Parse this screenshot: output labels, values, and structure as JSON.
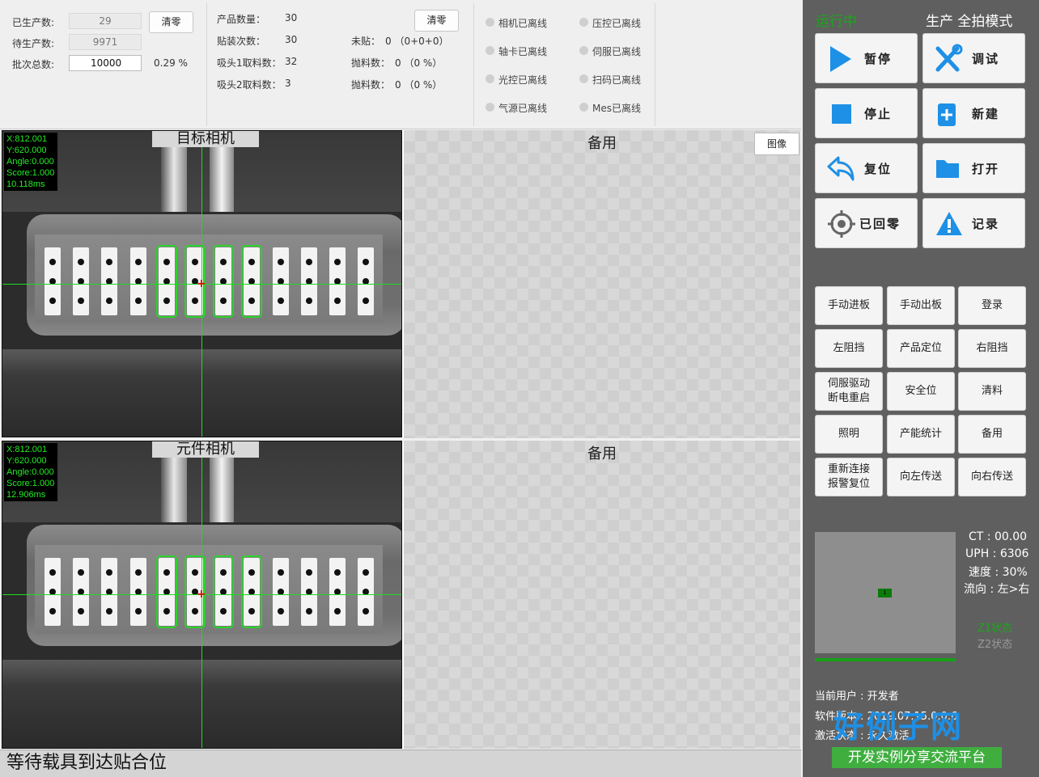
{
  "counters": {
    "produced_label": "已生产数:",
    "produced_value": "29",
    "remaining_label": "待生产数:",
    "remaining_value": "9971",
    "batch_label": "批次总数:",
    "batch_value": "10000",
    "batch_percent": "0.29 %",
    "clear_label": "清零"
  },
  "product": {
    "qty_label": "产品数量：",
    "qty_value": "30",
    "mount_label": "贴装次数：",
    "mount_value": "30",
    "nozzle1_label": "吸头1取料数：",
    "nozzle1_value": "32",
    "nozzle2_label": "吸头2取料数：",
    "nozzle2_value": "3",
    "unmounted_label": "未贴：",
    "unmounted_value": "0 （0+0+0）",
    "throw1_label": "抛料数：",
    "throw1_value": "0 （0 %）",
    "throw2_label": "抛料数：",
    "throw2_value": "0 （0 %）",
    "clear_label": "清零"
  },
  "statuses": [
    "相机已离线",
    "压控已离线",
    "轴卡已离线",
    "伺服已离线",
    "光控已离线",
    "扫码已离线",
    "气源已离线",
    "Mes已离线"
  ],
  "camera_target": {
    "title": "目标相机",
    "overlay": [
      "X:812.001",
      "Y:620.000",
      "Angle:0.000",
      "Score:1.000",
      "10.118ms"
    ]
  },
  "camera_part": {
    "title": "元件相机",
    "overlay": [
      "X:812.001",
      "Y:620.000",
      "Angle:0.000",
      "Score:1.000",
      "12.906ms"
    ]
  },
  "spare_title": "备用",
  "image_button": "图像",
  "status_message": "等待载具到达贴合位",
  "right": {
    "run_state": "运行中",
    "mode": "生产  全拍模式",
    "big_buttons": [
      {
        "label": "暂停",
        "icon": "play-icon"
      },
      {
        "label": "调试",
        "icon": "tools-icon"
      },
      {
        "label": "停止",
        "icon": "stop-icon"
      },
      {
        "label": "新建",
        "icon": "new-file-icon"
      },
      {
        "label": "复位",
        "icon": "undo-icon"
      },
      {
        "label": "打开",
        "icon": "folder-icon"
      },
      {
        "label": "已回零",
        "icon": "target-icon"
      },
      {
        "label": "记录",
        "icon": "warning-icon"
      }
    ],
    "small_buttons": [
      "手动进板",
      "手动出板",
      "登录",
      "左阻挡",
      "产品定位",
      "右阻挡",
      "伺服驱动\n断电重启",
      "安全位",
      "清料",
      "照明",
      "产能统计",
      "备用",
      "重新连接\n报警复位",
      "向左传送",
      "向右传送"
    ],
    "mini_label": "1",
    "ct": "CT : 00.00",
    "uph": "UPH : 6306",
    "speed": "速度 : 30%",
    "flow": "流向 : 左>右",
    "z1": "Z1状态",
    "z2": "Z2状态",
    "user": "当前用户 : 开发者",
    "version": "软件版本 : 2019.07.15.0.0.6",
    "activation": "激活状态 : 永久激活"
  },
  "watermark": {
    "main": "好例子网",
    "sub": "开发实例分享交流平台"
  },
  "colors": {
    "online_green": "#1ca61c",
    "accent_blue": "#1e90e6",
    "crosshair": "#1ddc1d"
  }
}
